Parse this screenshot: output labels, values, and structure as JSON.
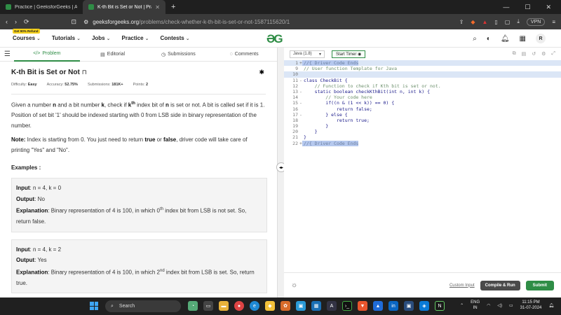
{
  "browser": {
    "tabs": [
      {
        "title": "Practice | GeeksforGeeks | A compu",
        "active": false
      },
      {
        "title": "K-th Bit is Set or Not | Practice |",
        "active": true
      }
    ],
    "new_tab": "+",
    "url_host": "geeksforgeeks.org",
    "url_path": "/problems/check-whether-k-th-bit-is-set-or-not-1587115620/1",
    "vpn_label": "VPN"
  },
  "nav": {
    "offer_badge": "Get 90% Refund",
    "items": [
      "Courses",
      "Tutorials",
      "Jobs",
      "Practice",
      "Contests"
    ],
    "logo": "ƏG",
    "avatar": "R"
  },
  "subtabs": [
    "Problem",
    "Editorial",
    "Submissions",
    "Comments"
  ],
  "problem": {
    "title": "K-th Bit is Set or Not",
    "difficulty_label": "Difficulty:",
    "difficulty": "Easy",
    "accuracy_label": "Accuracy:",
    "accuracy": "52.75%",
    "submissions_label": "Submissions:",
    "submissions": "181K+",
    "points_label": "Points:",
    "points": "2",
    "desc_1": "Given a number ",
    "desc_n": "n",
    "desc_2": " and a bit number ",
    "desc_k": "k",
    "desc_3": ", check if ",
    "desc_kth": "k",
    "desc_th": "th",
    "desc_4": " index bit of ",
    "desc_n2": "n",
    "desc_5": " is set or not. A bit is called set if it is 1. Position of set bit '1' should be indexed starting with 0 from LSB side in binary representation of the number.",
    "note_label": "Note:",
    "note_1": " Index is starting from 0. You just need to return ",
    "note_true": "true",
    "note_2": " or ",
    "note_false": "false",
    "note_3": ", driver code will take care of printing \"Yes\" and \"No\".",
    "examples_heading": "Examples :",
    "examples": [
      {
        "input_label": "Input",
        "input": ": n = 4, k = 0",
        "output_label": "Output",
        "output": ": No",
        "expl_label": "Explanation",
        "expl_1": ": Binary representation of 4 is 100, in which 0",
        "expl_sup": "th",
        "expl_2": " index bit from LSB is not set. So, return false."
      },
      {
        "input_label": "Input",
        "input": ": n = 4, k = 2",
        "output_label": "Output",
        "output": ": Yes",
        "expl_label": "Explanation",
        "expl_1": ": Binary representation of 4 is 100, in which 2",
        "expl_sup": "nd",
        "expl_2": " index bit from LSB is set. So, return true."
      }
    ]
  },
  "editor": {
    "language": "Java (1.8)",
    "timer": "Start Timer",
    "lines": [
      {
        "n": "1",
        "fold": "+",
        "text": "//{ Driver Code Ends",
        "cls": "hl sel-start"
      },
      {
        "n": "9",
        "fold": "",
        "text": "// User function Template for Java",
        "cls": "cmt"
      },
      {
        "n": "10",
        "fold": "",
        "text": "",
        "cls": "hl"
      },
      {
        "n": "11",
        "fold": "-",
        "text": "class CheckBit {",
        "cls": ""
      },
      {
        "n": "12",
        "fold": "",
        "text": "    // Function to check if Kth bit is set or not.",
        "cls": "cmt"
      },
      {
        "n": "13",
        "fold": "-",
        "text": "    static boolean checkKthBit(int n, int k) {",
        "cls": ""
      },
      {
        "n": "14",
        "fold": "",
        "text": "        // Your code here",
        "cls": "cmt"
      },
      {
        "n": "15",
        "fold": "-",
        "text": "        if((n & (1 << k)) == 0) {",
        "cls": ""
      },
      {
        "n": "16",
        "fold": "",
        "text": "            return false;",
        "cls": ""
      },
      {
        "n": "17",
        "fold": "-",
        "text": "        } else {",
        "cls": ""
      },
      {
        "n": "18",
        "fold": "",
        "text": "            return true;",
        "cls": ""
      },
      {
        "n": "19",
        "fold": "",
        "text": "        }",
        "cls": ""
      },
      {
        "n": "20",
        "fold": "",
        "text": "    }",
        "cls": ""
      },
      {
        "n": "21",
        "fold": "",
        "text": "}",
        "cls": ""
      },
      {
        "n": "22",
        "fold": "+",
        "text": "//{ Driver Code Ends",
        "cls": "sel-start"
      }
    ],
    "custom_input": "Custom Input",
    "compile_run": "Compile & Run",
    "submit": "Submit"
  },
  "taskbar": {
    "search": "Search",
    "lang_1": "ENG",
    "lang_2": "IN",
    "time": "11:15 PM",
    "date": "31-07-2024"
  }
}
